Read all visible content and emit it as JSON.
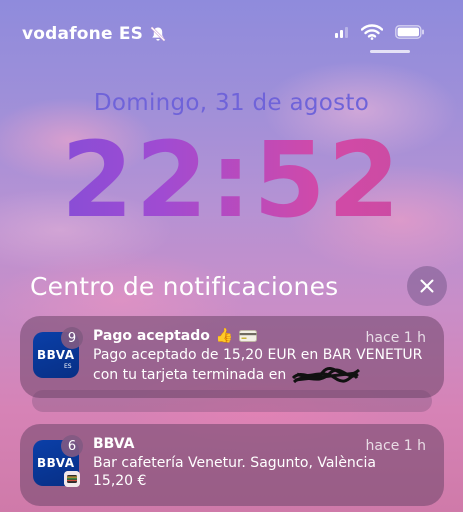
{
  "status_bar": {
    "carrier": "vodafone ES",
    "icons": [
      "bell-slash-icon",
      "signal-icon",
      "wifi-icon",
      "battery-icon"
    ]
  },
  "lock_screen": {
    "date": "Domingo, 31 de agosto",
    "time": "22:52"
  },
  "notification_center": {
    "title": "Centro de notificaciones",
    "clear_icon": "close-icon",
    "notifications": [
      {
        "app": "BBVA",
        "badge": "9",
        "title": "Pago aceptado",
        "title_emoji": [
          "thumbs-up-icon",
          "credit-card-icon"
        ],
        "time": "hace 1 h",
        "body": "Pago aceptado de 15,20 EUR en BAR VENETUR con tu tarjeta terminada en",
        "body_redacted": true
      },
      {
        "app": "BBVA",
        "badge": "6",
        "title": "BBVA",
        "time": "hace 1 h",
        "body_line1": "Bar cafetería Venetur. Sagunto, València",
        "body_line2": "15,20 €"
      }
    ]
  },
  "colors": {
    "date": "#6f63d9",
    "time_gradient_start": "#7a4fd8",
    "time_gradient_end": "#c64c9f",
    "bbva_blue": "#072f85"
  }
}
